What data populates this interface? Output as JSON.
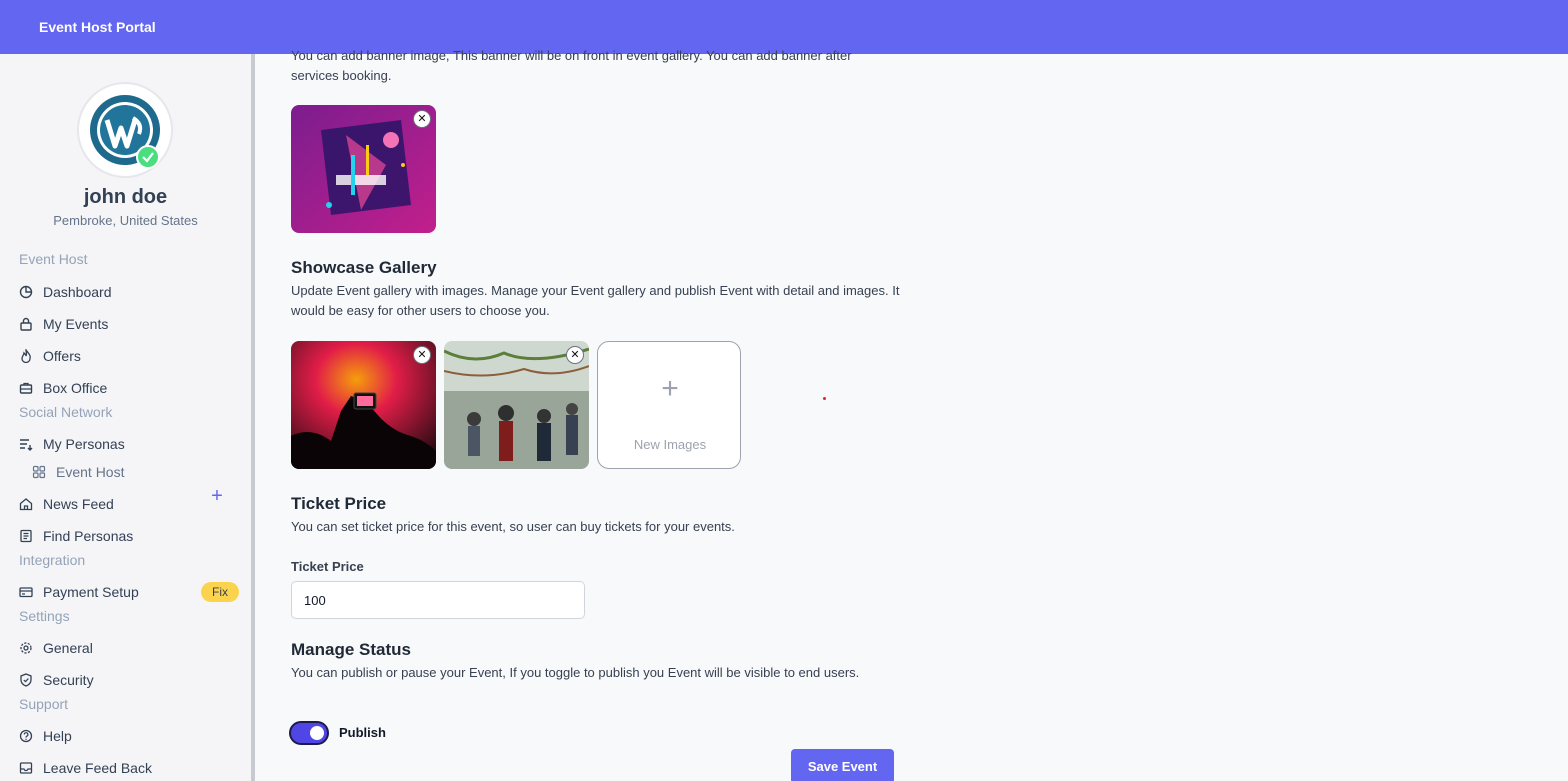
{
  "app": {
    "title": "Event Host Portal"
  },
  "user": {
    "name": "john doe",
    "location": "Pembroke, United States"
  },
  "sidebar": {
    "sections": [
      {
        "label": "Event Host"
      },
      {
        "label": "Social Network"
      },
      {
        "label": "Integration"
      },
      {
        "label": "Settings"
      },
      {
        "label": "Support"
      }
    ],
    "items": [
      {
        "label": "Dashboard",
        "icon": "pie-chart-icon"
      },
      {
        "label": "My Events",
        "icon": "lock-icon"
      },
      {
        "label": "Offers",
        "icon": "flame-icon"
      },
      {
        "label": "Box Office",
        "icon": "briefcase-icon"
      },
      {
        "label": "My Personas",
        "icon": "list-icon"
      },
      {
        "label": "Event Host",
        "icon": "grid-icon"
      },
      {
        "label": "News Feed",
        "icon": "home-icon"
      },
      {
        "label": "Find Personas",
        "icon": "document-icon"
      },
      {
        "label": "Payment Setup",
        "icon": "credit-card-icon"
      },
      {
        "label": "General",
        "icon": "gear-icon"
      },
      {
        "label": "Security",
        "icon": "shield-icon"
      },
      {
        "label": "Help",
        "icon": "help-circle-icon"
      },
      {
        "label": "Leave Feed Back",
        "icon": "feedback-icon"
      }
    ],
    "payment_badge": "Fix"
  },
  "banner": {
    "description": "You can add banner image, This banner will be on front in event gallery. You can add banner after services booking."
  },
  "gallery": {
    "title": "Showcase Gallery",
    "description": "Update Event gallery with images. Manage your Event gallery and publish Event with detail and images. It would be easy for other users to choose you.",
    "new_images_label": "New Images"
  },
  "ticket": {
    "title": "Ticket Price",
    "description": "You can set ticket price for this event, so user can buy tickets for your events.",
    "field_label": "Ticket Price",
    "value": "100"
  },
  "status": {
    "title": "Manage Status",
    "description": "You can publish or pause your Event, If you toggle to publish you Event will be visible to end users.",
    "toggle_label": "Publish",
    "published": true
  },
  "actions": {
    "save_label": "Save Event"
  },
  "colors": {
    "accent": "#6366f1",
    "badge": "#fcd34d",
    "verified": "#4ade80"
  }
}
